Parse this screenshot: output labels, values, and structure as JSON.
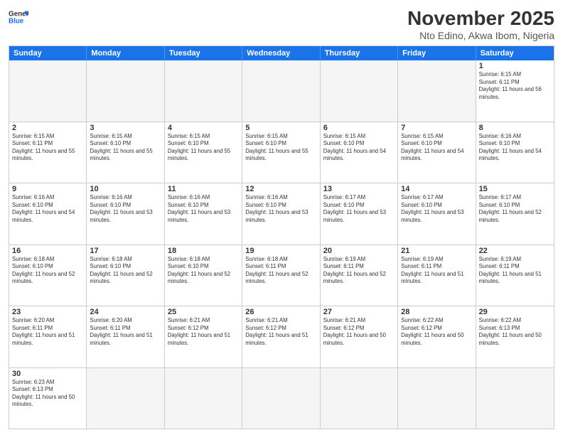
{
  "header": {
    "logo_general": "General",
    "logo_blue": "Blue",
    "title": "November 2025",
    "subtitle": "Nto Edino, Akwa Ibom, Nigeria"
  },
  "weekdays": [
    "Sunday",
    "Monday",
    "Tuesday",
    "Wednesday",
    "Thursday",
    "Friday",
    "Saturday"
  ],
  "rows": [
    [
      {
        "day": "",
        "empty": true
      },
      {
        "day": "",
        "empty": true
      },
      {
        "day": "",
        "empty": true
      },
      {
        "day": "",
        "empty": true
      },
      {
        "day": "",
        "empty": true
      },
      {
        "day": "",
        "empty": true
      },
      {
        "day": "1",
        "sunrise": "Sunrise: 6:15 AM",
        "sunset": "Sunset: 6:11 PM",
        "daylight": "Daylight: 11 hours and 56 minutes."
      }
    ],
    [
      {
        "day": "2",
        "sunrise": "Sunrise: 6:15 AM",
        "sunset": "Sunset: 6:11 PM",
        "daylight": "Daylight: 11 hours and 55 minutes."
      },
      {
        "day": "3",
        "sunrise": "Sunrise: 6:15 AM",
        "sunset": "Sunset: 6:10 PM",
        "daylight": "Daylight: 11 hours and 55 minutes."
      },
      {
        "day": "4",
        "sunrise": "Sunrise: 6:15 AM",
        "sunset": "Sunset: 6:10 PM",
        "daylight": "Daylight: 11 hours and 55 minutes."
      },
      {
        "day": "5",
        "sunrise": "Sunrise: 6:15 AM",
        "sunset": "Sunset: 6:10 PM",
        "daylight": "Daylight: 11 hours and 55 minutes."
      },
      {
        "day": "6",
        "sunrise": "Sunrise: 6:15 AM",
        "sunset": "Sunset: 6:10 PM",
        "daylight": "Daylight: 11 hours and 54 minutes."
      },
      {
        "day": "7",
        "sunrise": "Sunrise: 6:15 AM",
        "sunset": "Sunset: 6:10 PM",
        "daylight": "Daylight: 11 hours and 54 minutes."
      },
      {
        "day": "8",
        "sunrise": "Sunrise: 6:16 AM",
        "sunset": "Sunset: 6:10 PM",
        "daylight": "Daylight: 11 hours and 54 minutes."
      }
    ],
    [
      {
        "day": "9",
        "sunrise": "Sunrise: 6:16 AM",
        "sunset": "Sunset: 6:10 PM",
        "daylight": "Daylight: 11 hours and 54 minutes."
      },
      {
        "day": "10",
        "sunrise": "Sunrise: 6:16 AM",
        "sunset": "Sunset: 6:10 PM",
        "daylight": "Daylight: 11 hours and 53 minutes."
      },
      {
        "day": "11",
        "sunrise": "Sunrise: 6:16 AM",
        "sunset": "Sunset: 6:10 PM",
        "daylight": "Daylight: 11 hours and 53 minutes."
      },
      {
        "day": "12",
        "sunrise": "Sunrise: 6:16 AM",
        "sunset": "Sunset: 6:10 PM",
        "daylight": "Daylight: 11 hours and 53 minutes."
      },
      {
        "day": "13",
        "sunrise": "Sunrise: 6:17 AM",
        "sunset": "Sunset: 6:10 PM",
        "daylight": "Daylight: 11 hours and 53 minutes."
      },
      {
        "day": "14",
        "sunrise": "Sunrise: 6:17 AM",
        "sunset": "Sunset: 6:10 PM",
        "daylight": "Daylight: 11 hours and 53 minutes."
      },
      {
        "day": "15",
        "sunrise": "Sunrise: 6:17 AM",
        "sunset": "Sunset: 6:10 PM",
        "daylight": "Daylight: 11 hours and 52 minutes."
      }
    ],
    [
      {
        "day": "16",
        "sunrise": "Sunrise: 6:18 AM",
        "sunset": "Sunset: 6:10 PM",
        "daylight": "Daylight: 11 hours and 52 minutes."
      },
      {
        "day": "17",
        "sunrise": "Sunrise: 6:18 AM",
        "sunset": "Sunset: 6:10 PM",
        "daylight": "Daylight: 11 hours and 52 minutes."
      },
      {
        "day": "18",
        "sunrise": "Sunrise: 6:18 AM",
        "sunset": "Sunset: 6:10 PM",
        "daylight": "Daylight: 11 hours and 52 minutes."
      },
      {
        "day": "19",
        "sunrise": "Sunrise: 6:18 AM",
        "sunset": "Sunset: 6:11 PM",
        "daylight": "Daylight: 11 hours and 52 minutes."
      },
      {
        "day": "20",
        "sunrise": "Sunrise: 6:19 AM",
        "sunset": "Sunset: 6:11 PM",
        "daylight": "Daylight: 11 hours and 52 minutes."
      },
      {
        "day": "21",
        "sunrise": "Sunrise: 6:19 AM",
        "sunset": "Sunset: 6:11 PM",
        "daylight": "Daylight: 11 hours and 51 minutes."
      },
      {
        "day": "22",
        "sunrise": "Sunrise: 6:19 AM",
        "sunset": "Sunset: 6:11 PM",
        "daylight": "Daylight: 11 hours and 51 minutes."
      }
    ],
    [
      {
        "day": "23",
        "sunrise": "Sunrise: 6:20 AM",
        "sunset": "Sunset: 6:11 PM",
        "daylight": "Daylight: 11 hours and 51 minutes."
      },
      {
        "day": "24",
        "sunrise": "Sunrise: 6:20 AM",
        "sunset": "Sunset: 6:11 PM",
        "daylight": "Daylight: 11 hours and 51 minutes."
      },
      {
        "day": "25",
        "sunrise": "Sunrise: 6:21 AM",
        "sunset": "Sunset: 6:12 PM",
        "daylight": "Daylight: 11 hours and 51 minutes."
      },
      {
        "day": "26",
        "sunrise": "Sunrise: 6:21 AM",
        "sunset": "Sunset: 6:12 PM",
        "daylight": "Daylight: 11 hours and 51 minutes."
      },
      {
        "day": "27",
        "sunrise": "Sunrise: 6:21 AM",
        "sunset": "Sunset: 6:12 PM",
        "daylight": "Daylight: 11 hours and 50 minutes."
      },
      {
        "day": "28",
        "sunrise": "Sunrise: 6:22 AM",
        "sunset": "Sunset: 6:12 PM",
        "daylight": "Daylight: 11 hours and 50 minutes."
      },
      {
        "day": "29",
        "sunrise": "Sunrise: 6:22 AM",
        "sunset": "Sunset: 6:13 PM",
        "daylight": "Daylight: 11 hours and 50 minutes."
      }
    ],
    [
      {
        "day": "30",
        "sunrise": "Sunrise: 6:23 AM",
        "sunset": "Sunset: 6:13 PM",
        "daylight": "Daylight: 11 hours and 50 minutes."
      },
      {
        "day": "",
        "empty": true
      },
      {
        "day": "",
        "empty": true
      },
      {
        "day": "",
        "empty": true
      },
      {
        "day": "",
        "empty": true
      },
      {
        "day": "",
        "empty": true
      },
      {
        "day": "",
        "empty": true
      }
    ]
  ]
}
